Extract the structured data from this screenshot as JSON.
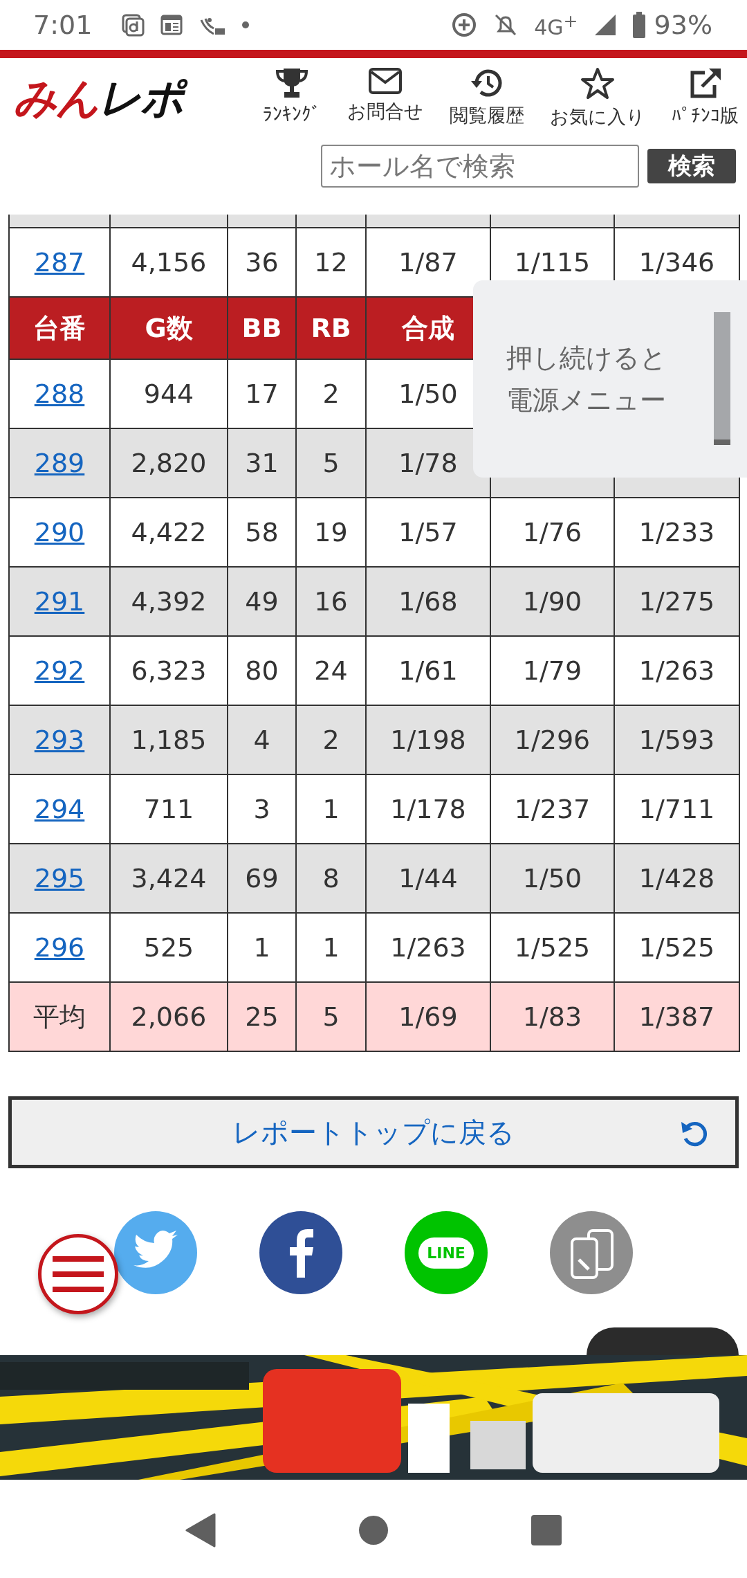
{
  "status_bar": {
    "time": "7:01",
    "network": "4G$^{+}$",
    "battery": "93%"
  },
  "header": {
    "logo_main": "みん",
    "logo_accent": "レポ",
    "nav": [
      {
        "kind": "trophy",
        "label": "ﾗﾝｷﾝｸﾞ"
      },
      {
        "kind": "mail",
        "label": "お問合せ"
      },
      {
        "kind": "history",
        "label": "閲覧履歴"
      },
      {
        "kind": "star",
        "label": "お気に入り"
      },
      {
        "kind": "external",
        "label": "ﾊﾟﾁﾝｺ版"
      }
    ]
  },
  "search": {
    "placeholder": "ホール名で検索",
    "button": "検索"
  },
  "table": {
    "rows": [
      {
        "kind": "data",
        "shaded": false,
        "number": "287",
        "cells": [
          "4,156",
          "36",
          "12",
          "1/87",
          "1/115",
          "1/346"
        ]
      },
      {
        "kind": "header",
        "label": "台番",
        "cells": [
          "G数",
          "BB",
          "RB",
          "合成"
        ]
      },
      {
        "kind": "data",
        "shaded": false,
        "number": "288",
        "cells": [
          "944",
          "17",
          "2",
          "1/50"
        ]
      },
      {
        "kind": "data",
        "shaded": true,
        "number": "289",
        "cells": [
          "2,820",
          "31",
          "5",
          "1/78"
        ]
      },
      {
        "kind": "data",
        "shaded": false,
        "number": "290",
        "cells": [
          "4,422",
          "58",
          "19",
          "1/57",
          "1/76",
          "1/233"
        ]
      },
      {
        "kind": "data",
        "shaded": true,
        "number": "291",
        "cells": [
          "4,392",
          "49",
          "16",
          "1/68",
          "1/90",
          "1/275"
        ]
      },
      {
        "kind": "data",
        "shaded": false,
        "number": "292",
        "cells": [
          "6,323",
          "80",
          "24",
          "1/61",
          "1/79",
          "1/263"
        ]
      },
      {
        "kind": "data",
        "shaded": true,
        "number": "293",
        "cells": [
          "1,185",
          "4",
          "2",
          "1/198",
          "1/296",
          "1/593"
        ]
      },
      {
        "kind": "data",
        "shaded": false,
        "number": "294",
        "cells": [
          "711",
          "3",
          "1",
          "1/178",
          "1/237",
          "1/711"
        ]
      },
      {
        "kind": "data",
        "shaded": true,
        "number": "295",
        "cells": [
          "3,424",
          "69",
          "8",
          "1/44",
          "1/50",
          "1/428"
        ]
      },
      {
        "kind": "data",
        "shaded": false,
        "number": "296",
        "cells": [
          "525",
          "1",
          "1",
          "1/263",
          "1/525",
          "1/525"
        ]
      },
      {
        "kind": "average",
        "label": "平均",
        "cells": [
          "2,066",
          "25",
          "5",
          "1/69",
          "1/83",
          "1/387"
        ]
      }
    ]
  },
  "tooltip": {
    "text": "押し続けると電源メニュー"
  },
  "report_button": {
    "label": "レポートトップに戻る"
  },
  "share": [
    {
      "kind": "twitter"
    },
    {
      "kind": "facebook"
    },
    {
      "kind": "line",
      "label": "LINE"
    },
    {
      "kind": "copy"
    }
  ]
}
